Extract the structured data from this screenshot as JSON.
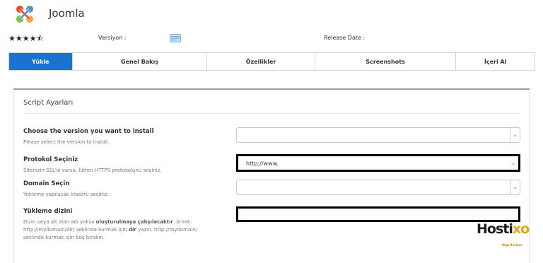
{
  "header": {
    "title": "Joomla",
    "rating_stars": "★★★★⯪",
    "version_label": "Versiyon :",
    "release_label": "Release Date :"
  },
  "tabs": [
    {
      "label": "Yükle",
      "active": true
    },
    {
      "label": "Genel Bakış",
      "active": false
    },
    {
      "label": "Özellikler",
      "active": false
    },
    {
      "label": "Screenshots",
      "active": false
    },
    {
      "label": "İçeri Al",
      "active": false
    }
  ],
  "section": {
    "title": "Script Ayarları"
  },
  "fields": {
    "version": {
      "title": "Choose the version you want to install",
      "help": "Please select the version to install.",
      "value": ""
    },
    "protocol": {
      "title": "Protokol Seçiniz",
      "help": "Sitenizin SSL'si varsa, lütfen HTTPS protokolünü seçiniz.",
      "value": "http://www."
    },
    "domain": {
      "title": "Domain Seçin",
      "help": "Yükleme yapılacak klasörü seçiniz.",
      "value": ""
    },
    "directory": {
      "title": "Yükleme dizini",
      "help_1": "Dizin veya alt alan adı yoksa ",
      "help_bold": "oluşturulmaya çalışılacaktır",
      "help_2": ". örnek:",
      "help_3": "http://mydomain/dir/ şeklinde kurmak için ",
      "help_dir": "dir",
      "help_4": " yazın. http://mydomain/",
      "help_5": "şeklinde kurmak için boş bırakın.",
      "value": ""
    }
  },
  "watermark": {
    "brand_main": "Hosti",
    "brand_accent": "xo",
    "tagline": "Bilgi Bankası"
  },
  "colors": {
    "active_tab": "#1a73d1",
    "redaction": "#000000",
    "brand_accent": "#e8a317"
  }
}
